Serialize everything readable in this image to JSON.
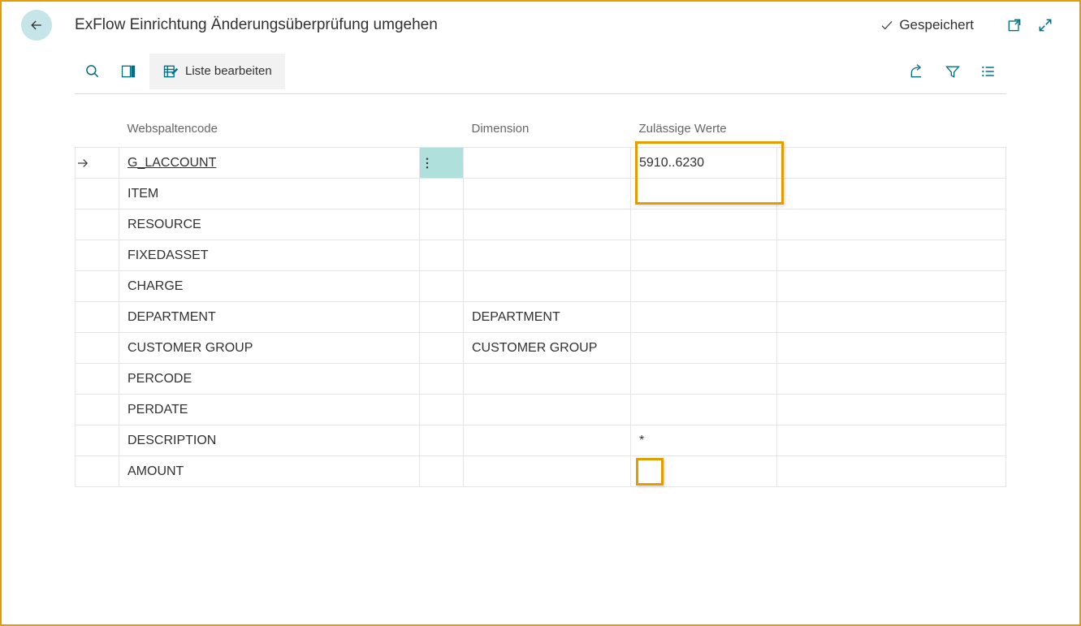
{
  "header": {
    "title": "ExFlow Einrichtung Änderungsüberprüfung umgehen",
    "saved_label": "Gespeichert"
  },
  "toolbar": {
    "edit_list_label": "Liste bearbeiten"
  },
  "table": {
    "headers": {
      "code": "Webspaltencode",
      "dimension": "Dimension",
      "allowed": "Zulässige Werte"
    },
    "rows": [
      {
        "code": "G_LACCOUNT",
        "dimension": "",
        "allowed": "5910..6230",
        "selected": true,
        "underline": true
      },
      {
        "code": "ITEM",
        "dimension": "",
        "allowed": "",
        "selected": false,
        "underline": false
      },
      {
        "code": "RESOURCE",
        "dimension": "",
        "allowed": "",
        "selected": false,
        "underline": false
      },
      {
        "code": "FIXEDASSET",
        "dimension": "",
        "allowed": "",
        "selected": false,
        "underline": false
      },
      {
        "code": "CHARGE",
        "dimension": "",
        "allowed": "",
        "selected": false,
        "underline": false
      },
      {
        "code": "DEPARTMENT",
        "dimension": "DEPARTMENT",
        "allowed": "",
        "selected": false,
        "underline": false
      },
      {
        "code": "CUSTOMER GROUP",
        "dimension": "CUSTOMER GROUP",
        "allowed": "",
        "selected": false,
        "underline": false
      },
      {
        "code": "PERCODE",
        "dimension": "",
        "allowed": "",
        "selected": false,
        "underline": false
      },
      {
        "code": "PERDATE",
        "dimension": "",
        "allowed": "",
        "selected": false,
        "underline": false
      },
      {
        "code": "DESCRIPTION",
        "dimension": "",
        "allowed": "*",
        "selected": false,
        "underline": false
      },
      {
        "code": "AMOUNT",
        "dimension": "",
        "allowed": "",
        "selected": false,
        "underline": false
      }
    ]
  }
}
